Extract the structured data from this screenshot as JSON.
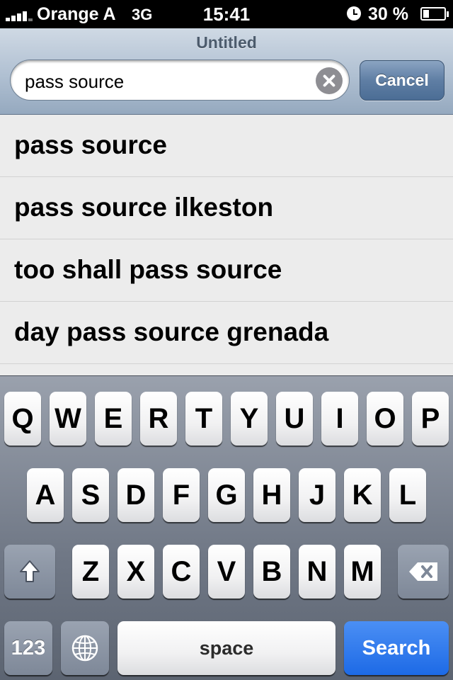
{
  "status_bar": {
    "carrier": "Orange A",
    "network": "3G",
    "time": "15:41",
    "battery": "30 %",
    "battery_level_percent": 30
  },
  "header": {
    "title": "Untitled",
    "search_value": "pass source",
    "cancel_label": "Cancel"
  },
  "suggestions": [
    "pass source",
    "pass source ilkeston",
    "too shall pass source",
    "day pass source grenada"
  ],
  "keyboard": {
    "row1": [
      "Q",
      "W",
      "E",
      "R",
      "T",
      "Y",
      "U",
      "I",
      "O",
      "P"
    ],
    "row2": [
      "A",
      "S",
      "D",
      "F",
      "G",
      "H",
      "J",
      "K",
      "L"
    ],
    "row3": [
      "Z",
      "X",
      "C",
      "V",
      "B",
      "N",
      "M"
    ],
    "numbers_label": "123",
    "space_label": "space",
    "search_label": "Search",
    "icons": {
      "shift": "shift-icon",
      "backspace": "backspace-icon",
      "globe": "globe-icon",
      "clear": "clear-icon"
    }
  },
  "colors": {
    "search_key": "#1d6ae6",
    "header": "#b0c0d2",
    "suggestions_bg": "#ececec"
  }
}
